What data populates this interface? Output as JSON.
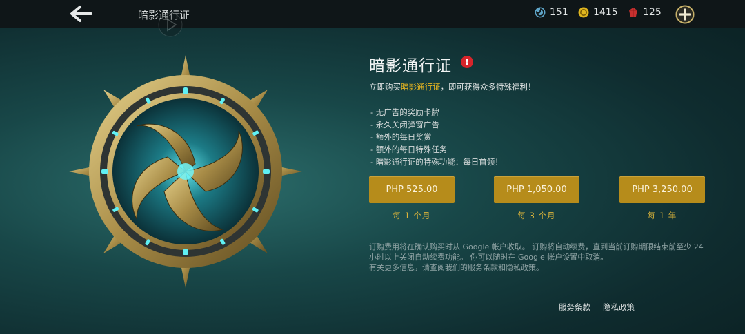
{
  "header": {
    "title": "暗影通行证",
    "back_icon": "back-arrow-icon",
    "currencies": [
      {
        "icon": "blue-swirl-currency-icon",
        "value": "151",
        "color": "#5fa6c9"
      },
      {
        "icon": "gold-coin-icon",
        "value": "1415",
        "color": "#e0b71f"
      },
      {
        "icon": "red-gem-icon",
        "value": "125",
        "color": "#c8302f"
      }
    ],
    "add_icon": "add-currency-icon"
  },
  "panel": {
    "title": "暗影通行证",
    "alert_icon": "alert-icon",
    "alert_glyph": "!",
    "intro_prefix": "立即购买",
    "intro_highlight": "暗影通行证",
    "intro_suffix": "，即可获得众多特殊福利！",
    "benefits": [
      "- 无广告的奖励卡牌",
      "- 永久关闭弹窗广告",
      "- 额外的每日奖赏",
      "- 额外的每日特殊任务",
      "- 暗影通行证的特殊功能：每日首领！"
    ]
  },
  "plans": [
    {
      "price": "PHP 525.00",
      "period": "每 1 个月"
    },
    {
      "price": "PHP 1,050.00",
      "period": "每 3 个月"
    },
    {
      "price": "PHP 3,250.00",
      "period": "每 1 年"
    }
  ],
  "disclaimer": {
    "line1": "订购费用将在确认购买时从 Google 帐户收取。 订购将自动续费，直到当前订购期限结束前至少 24",
    "line2": "小时以上关闭自动续费功能。 你可以随时在 Google 帐户设置中取消。",
    "line3": "有关更多信息，请查阅我们的服务条款和隐私政策。"
  },
  "footer": {
    "terms": "服务条款",
    "privacy": "隐私政策"
  },
  "colors": {
    "accent_gold": "#b68c1b",
    "highlight": "#e8b620",
    "background": "#184748"
  }
}
